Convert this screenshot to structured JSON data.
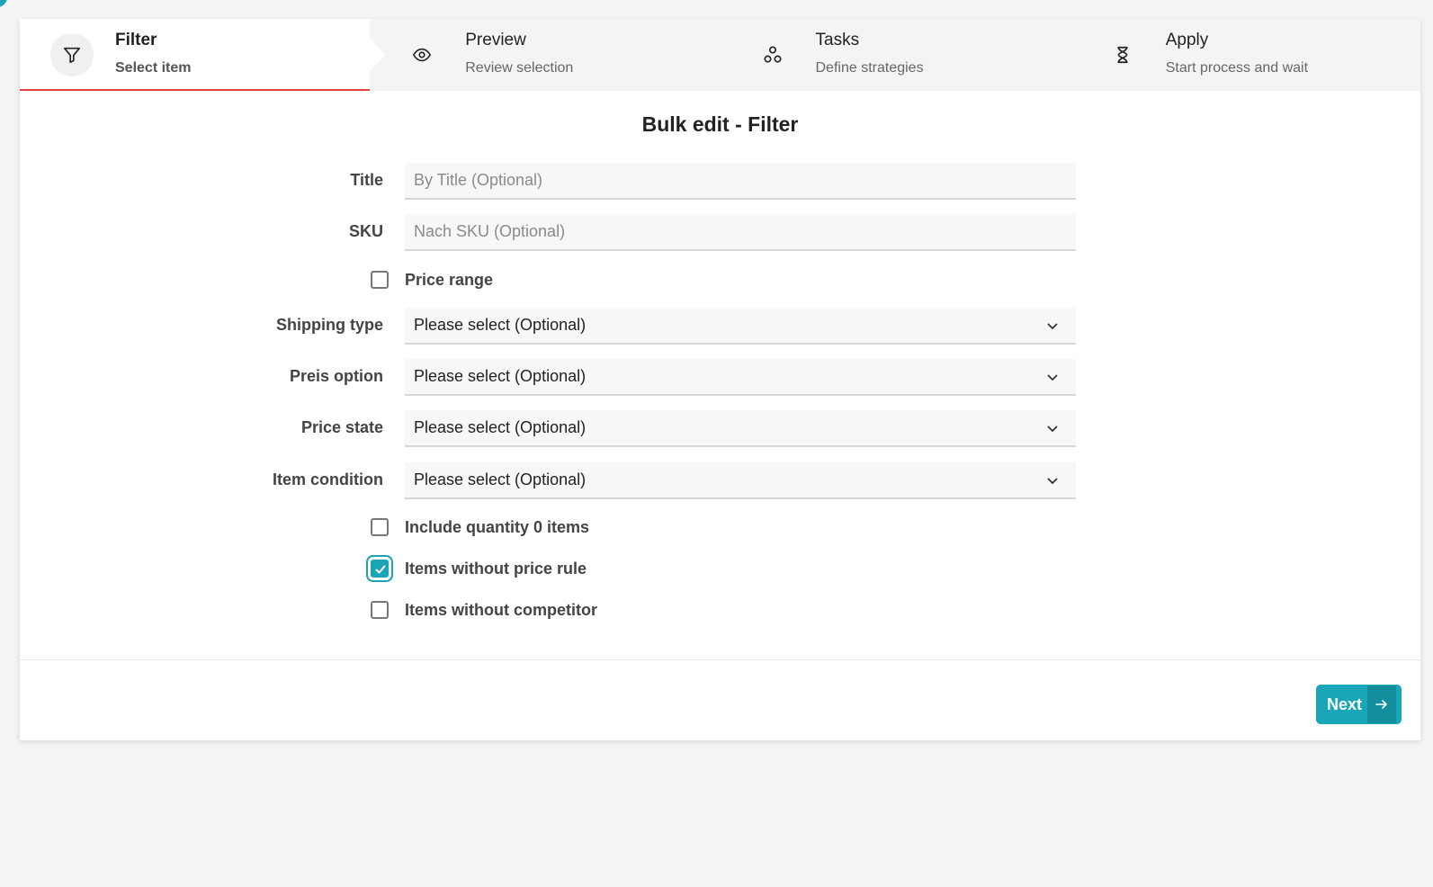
{
  "stepper": {
    "steps": [
      {
        "title": "Filter",
        "subtitle": "Select item",
        "icon": "filter-icon",
        "active": true
      },
      {
        "title": "Preview",
        "subtitle": "Review selection",
        "icon": "eye-icon",
        "active": false
      },
      {
        "title": "Tasks",
        "subtitle": "Define strategies",
        "icon": "nodes-icon",
        "active": false
      },
      {
        "title": "Apply",
        "subtitle": "Start process and wait",
        "icon": "hourglass-icon",
        "active": false
      }
    ]
  },
  "form": {
    "heading": "Bulk edit - Filter",
    "title": {
      "label": "Title",
      "value": "",
      "placeholder": "By Title (Optional)"
    },
    "sku": {
      "label": "SKU",
      "value": "",
      "placeholder": "Nach SKU (Optional)"
    },
    "price_range": {
      "label": "Price range",
      "checked": false
    },
    "shipping_type": {
      "label": "Shipping type",
      "value": "Please select (Optional)"
    },
    "preis_option": {
      "label": "Preis option",
      "value": "Please select (Optional)"
    },
    "price_state": {
      "label": "Price state",
      "value": "Please select (Optional)"
    },
    "item_condition": {
      "label": "Item condition",
      "value": "Please select (Optional)"
    },
    "include_qty_zero": {
      "label": "Include quantity 0 items",
      "checked": false
    },
    "without_price_rule": {
      "label": "Items without price rule",
      "checked": true
    },
    "without_competitor": {
      "label": "Items without competitor",
      "checked": false
    }
  },
  "footer": {
    "next_label": "Next"
  },
  "colors": {
    "accent": "#1aa6b7",
    "active_underline": "#e0463a",
    "background": "#f4f4f4"
  }
}
